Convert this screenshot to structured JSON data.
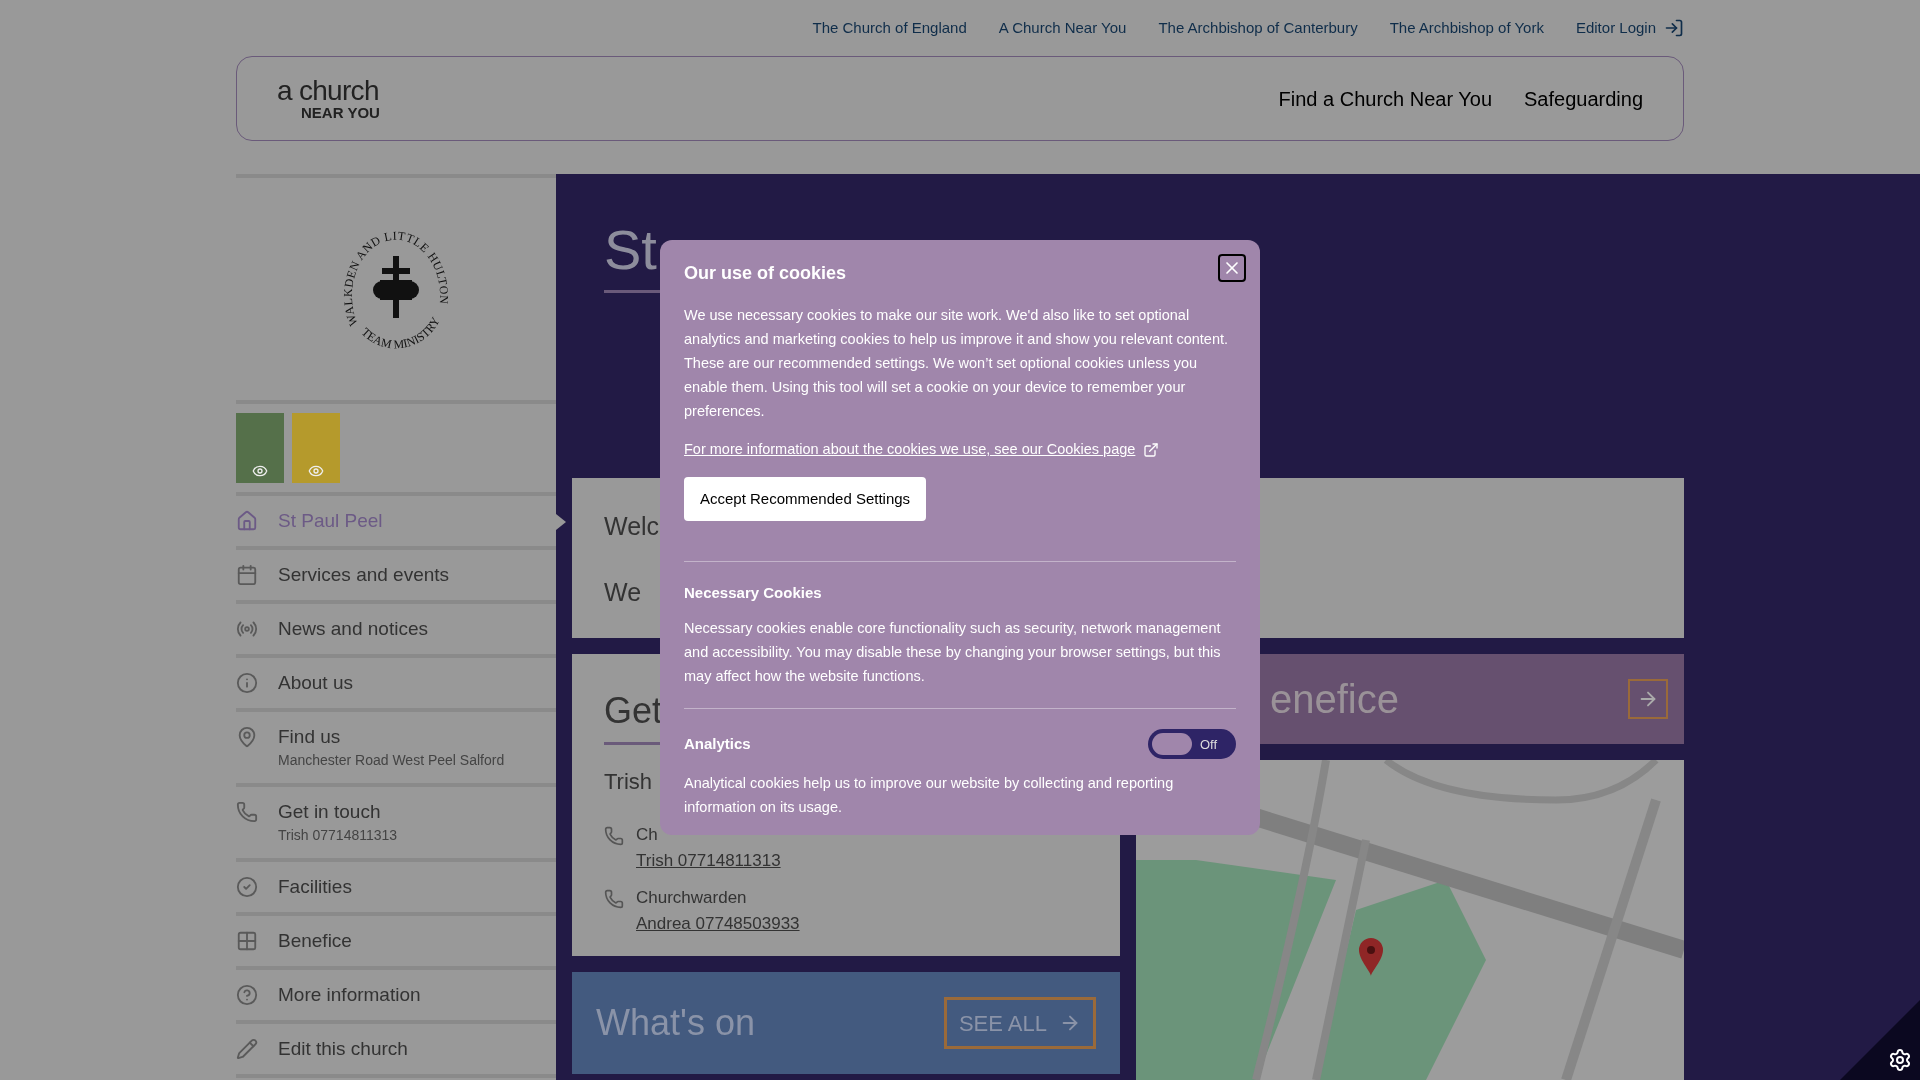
{
  "top_links": [
    {
      "label": "The Church of England"
    },
    {
      "label": "A Church Near You"
    },
    {
      "label": "The Archbishop of Canterbury"
    },
    {
      "label": "The Archbishop of York"
    },
    {
      "label": "Editor Login",
      "kind": "login"
    }
  ],
  "header": {
    "logo_top": "a church",
    "logo_bottom": "NEAR YOU",
    "nav": [
      "Find a Church Near You",
      "Safeguarding"
    ]
  },
  "emblem": {
    "top": "WALKDEN AND LITTLE HULTON",
    "bottom": "TEAM MINISTRY"
  },
  "sidebar": [
    {
      "label": "St Paul Peel",
      "selected": true
    },
    {
      "label": "Services and events",
      "selected": false
    },
    {
      "label": "News and notices",
      "selected": false
    },
    {
      "label": "About us",
      "selected": false
    },
    {
      "label": "Find us",
      "sub": "Manchester Road West Peel Salford",
      "selected": false
    },
    {
      "label": "Get in touch",
      "sub": "Trish 07714811313",
      "selected": false
    },
    {
      "label": "Facilities",
      "selected": false
    },
    {
      "label": "Benefice",
      "selected": false
    },
    {
      "label": "More information",
      "selected": false
    },
    {
      "label": "Edit this church",
      "selected": false
    }
  ],
  "page_title": "St",
  "welcome": {
    "heading": "Welc",
    "text": "We"
  },
  "get_in_touch": {
    "heading": "Get",
    "name": "Trish",
    "contacts": [
      {
        "role": "Ch",
        "link": "Trish 07714811313"
      },
      {
        "role": "Churchwarden",
        "link": "Andrea 07748503933"
      }
    ]
  },
  "benefice": {
    "label": "enefice"
  },
  "whats_on": {
    "heading": "What's on",
    "button": "SEE ALL"
  },
  "cookie_dialog": {
    "title": "Our use of cookies",
    "intro": "We use necessary cookies to make our site work. We'd also like to set optional analytics and marketing cookies to help us improve it and show you relevant content. These are our recommended settings. We won’t set optional cookies unless you enable them. Using this tool will set a cookie on your device to remember your preferences.",
    "link": "For more information about the cookies we use, see our Cookies page",
    "accept": "Accept Recommended Settings",
    "sections": [
      {
        "kind": "info",
        "title": "Necessary Cookies",
        "text": "Necessary cookies enable core functionality such as security, network management and accessibility. You may disable these by changing your browser settings, but this may affect how the website functions."
      },
      {
        "kind": "toggle",
        "title": "Analytics",
        "on": false,
        "state_label": "Off",
        "text": "Analytical cookies help us to improve our website by collecting and reporting information on its usage."
      }
    ]
  }
}
